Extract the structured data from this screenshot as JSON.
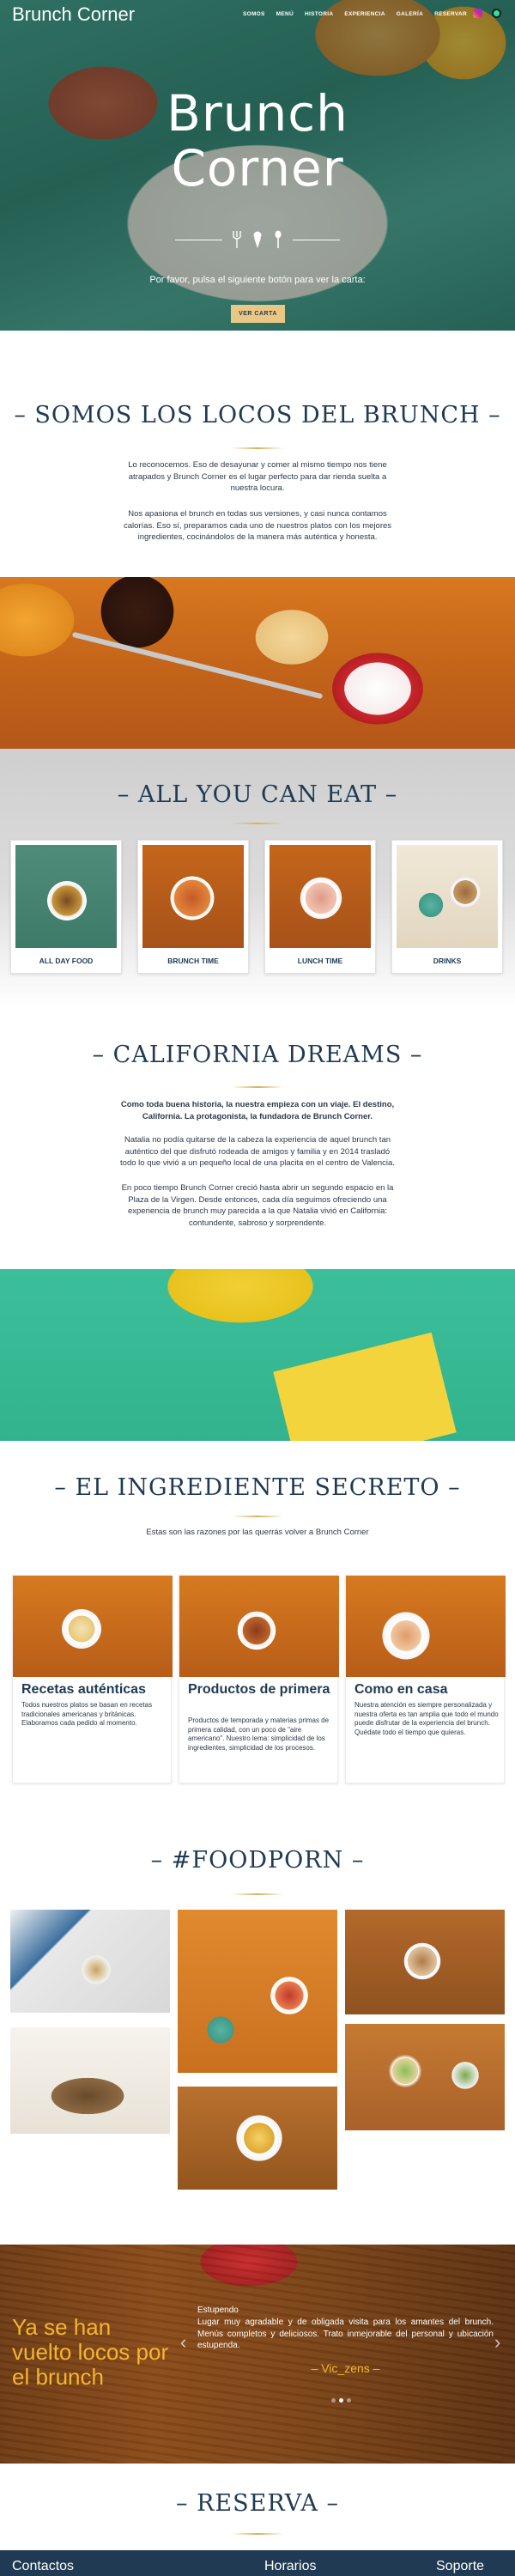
{
  "header": {
    "brand": "Brunch Corner",
    "nav": [
      "SOMOS",
      "MENÚ",
      "HISTORIA",
      "EXPERIENCIA",
      "GALERÍA",
      "RESERVAR"
    ],
    "social": [
      "instagram-icon",
      "tripadvisor-icon"
    ]
  },
  "hero": {
    "title_line1": "Brunch",
    "title_line2": "Corner",
    "icons": [
      "fork-icon",
      "ice-cream-icon",
      "spoon-icon"
    ],
    "subtitle": "Por favor, pulsa el siguiente botón para ver la carta:",
    "button": "VER CARTA"
  },
  "about": {
    "title": "– SOMOS LOS LOCOS DEL BRUNCH –",
    "p1": "Lo reconocemos. Eso de desayunar y comer al mismo tiempo nos tiene atrapados y Brunch Corner es el lugar perfecto para dar rienda suelta a nuestra locura.",
    "p2": "Nos apasiona el brunch en todas sus versiones, y casi nunca contamos calorías. Eso sí, preparamos cada uno de nuestros platos con los mejores ingredientes, cocinándolos de la manera más auténtica y honesta."
  },
  "menu": {
    "title": "– ALL YOU CAN EAT –",
    "cards": [
      {
        "label": "ALL DAY FOOD"
      },
      {
        "label": "BRUNCH TIME"
      },
      {
        "label": "LUNCH TIME"
      },
      {
        "label": "DRINKS"
      }
    ]
  },
  "history": {
    "title": "– CALIFORNIA DREAMS –",
    "lead": "Como toda buena historia, la nuestra empieza con un viaje. El destino, California. La protagonista, la fundadora de Brunch Corner.",
    "p1": "Natalia no podía quitarse de la cabeza la experiencia de aquel brunch tan auténtico del que disfrutó rodeada de amigos y familia y en 2014 trasladó todo lo que vivió a un pequeño local de una placita en el centro de Valencia.",
    "p2": "En poco tiempo Brunch Corner creció hasta abrir un segundo espacio en la Plaza de la Virgen. Desde entonces, cada día seguimos ofreciendo una experiencia de brunch muy parecida a la que Natalia vivió en California: contundente, sabroso y sorprendente."
  },
  "experience": {
    "title": "– EL INGREDIENTE SECRETO –",
    "intro": "Estas son las razones por las querrás volver a Brunch Corner",
    "items": [
      {
        "title": "Recetas auténticas",
        "text": "Todos nuestros platos se basan en recetas tradicionales americanas y británicas. Elaboramos cada pedido al momento."
      },
      {
        "title": "Productos de primera",
        "text": "Productos de temporada y materias primas de primera calidad, con un poco de \"aire americano\". Nuestro lema: simplicidad de los ingredientes, simplicidad de los procesos."
      },
      {
        "title": "Como en casa",
        "text": "Nuestra atención es siempre personalizada y nuestra oferta es tan amplia que todo el mundo puede disfrutar de la experiencia del brunch. Quédate todo el tiempo que quieras."
      }
    ]
  },
  "gallery": {
    "title": "– #FOODPORN –"
  },
  "testimonials": {
    "headline": "Ya se han vuelto locos por el brunch",
    "name": "Estupendo",
    "text": "Lugar muy agradable y de obligada visita para los amantes del brunch. Menús completos y deliciosos. Trato inmejorable del personal y ubicación estupenda.",
    "author": "– Vic_zens –",
    "dots_total": 3,
    "dots_active": 2
  },
  "booking": {
    "title": "– RESERVA –"
  },
  "footer": {
    "cols": [
      "Contactos",
      "Horarios",
      "Soporte"
    ]
  }
}
